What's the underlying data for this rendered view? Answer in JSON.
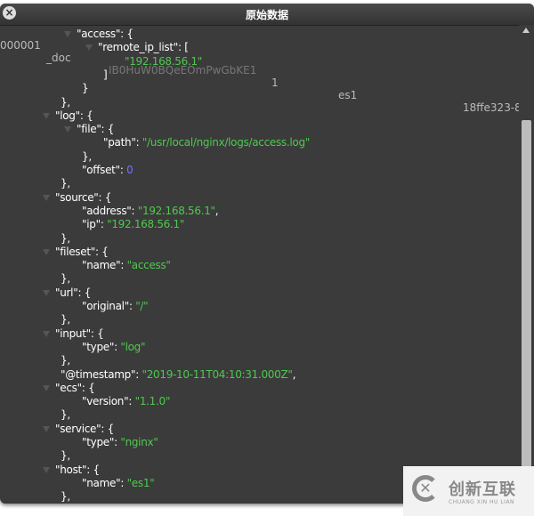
{
  "window": {
    "title": "原始数据",
    "close_icon": "close-icon"
  },
  "background_row": [
    "000001",
    "_doc",
    "IB0HuW0BQeEOmPwGbKE1",
    "1",
    "es1",
    "18ffe323-8"
  ],
  "json_lines": [
    {
      "l": 3,
      "a": true,
      "k": "access",
      "p": ": {"
    },
    {
      "l": 4,
      "a": true,
      "k": "remote_ip_list",
      "p": ": ["
    },
    {
      "l": 5,
      "v": "\"192.168.56.1\"",
      "t": "str"
    },
    {
      "l": 4,
      "p": "]"
    },
    {
      "l": 3,
      "p": "}"
    },
    {
      "l": 2,
      "p": "},"
    },
    {
      "l": 2,
      "a": true,
      "k": "log",
      "p": ": {"
    },
    {
      "l": 3,
      "a": true,
      "k": "file",
      "p": ": {"
    },
    {
      "l": 4,
      "k": "path",
      "p": ": ",
      "v": "\"/usr/local/nginx/logs/access.log\"",
      "t": "str"
    },
    {
      "l": 3,
      "p": "},"
    },
    {
      "l": 3,
      "k": "offset",
      "p": ": ",
      "v": "0",
      "t": "num"
    },
    {
      "l": 2,
      "p": "},"
    },
    {
      "l": 2,
      "a": true,
      "k": "source",
      "p": ": {"
    },
    {
      "l": 3,
      "k": "address",
      "p": ": ",
      "v": "\"192.168.56.1\"",
      "t": "str",
      "c": ","
    },
    {
      "l": 3,
      "k": "ip",
      "p": ": ",
      "v": "\"192.168.56.1\"",
      "t": "str"
    },
    {
      "l": 2,
      "p": "},"
    },
    {
      "l": 2,
      "a": true,
      "k": "fileset",
      "p": ": {"
    },
    {
      "l": 3,
      "k": "name",
      "p": ": ",
      "v": "\"access\"",
      "t": "str"
    },
    {
      "l": 2,
      "p": "},"
    },
    {
      "l": 2,
      "a": true,
      "k": "url",
      "p": ": {"
    },
    {
      "l": 3,
      "k": "original",
      "p": ": ",
      "v": "\"/\"",
      "t": "str"
    },
    {
      "l": 2,
      "p": "},"
    },
    {
      "l": 2,
      "a": true,
      "k": "input",
      "p": ": {"
    },
    {
      "l": 3,
      "k": "type",
      "p": ": ",
      "v": "\"log\"",
      "t": "str"
    },
    {
      "l": 2,
      "p": "},"
    },
    {
      "l": 2,
      "k": "@timestamp",
      "p": ": ",
      "v": "\"2019-10-11T04:10:31.000Z\"",
      "t": "str",
      "c": ","
    },
    {
      "l": 2,
      "a": true,
      "k": "ecs",
      "p": ": {"
    },
    {
      "l": 3,
      "k": "version",
      "p": ": ",
      "v": "\"1.1.0\"",
      "t": "str"
    },
    {
      "l": 2,
      "p": "},"
    },
    {
      "l": 2,
      "a": true,
      "k": "service",
      "p": ": {"
    },
    {
      "l": 3,
      "k": "type",
      "p": ": ",
      "v": "\"nginx\"",
      "t": "str"
    },
    {
      "l": 2,
      "p": "},"
    },
    {
      "l": 2,
      "a": true,
      "k": "host",
      "p": ": {"
    },
    {
      "l": 3,
      "k": "name",
      "p": ": ",
      "v": "\"es1\"",
      "t": "str"
    },
    {
      "l": 2,
      "p": "},"
    }
  ],
  "watermark": {
    "cn": "创新互联",
    "en": "CHUANG XIN HU LIAN"
  }
}
